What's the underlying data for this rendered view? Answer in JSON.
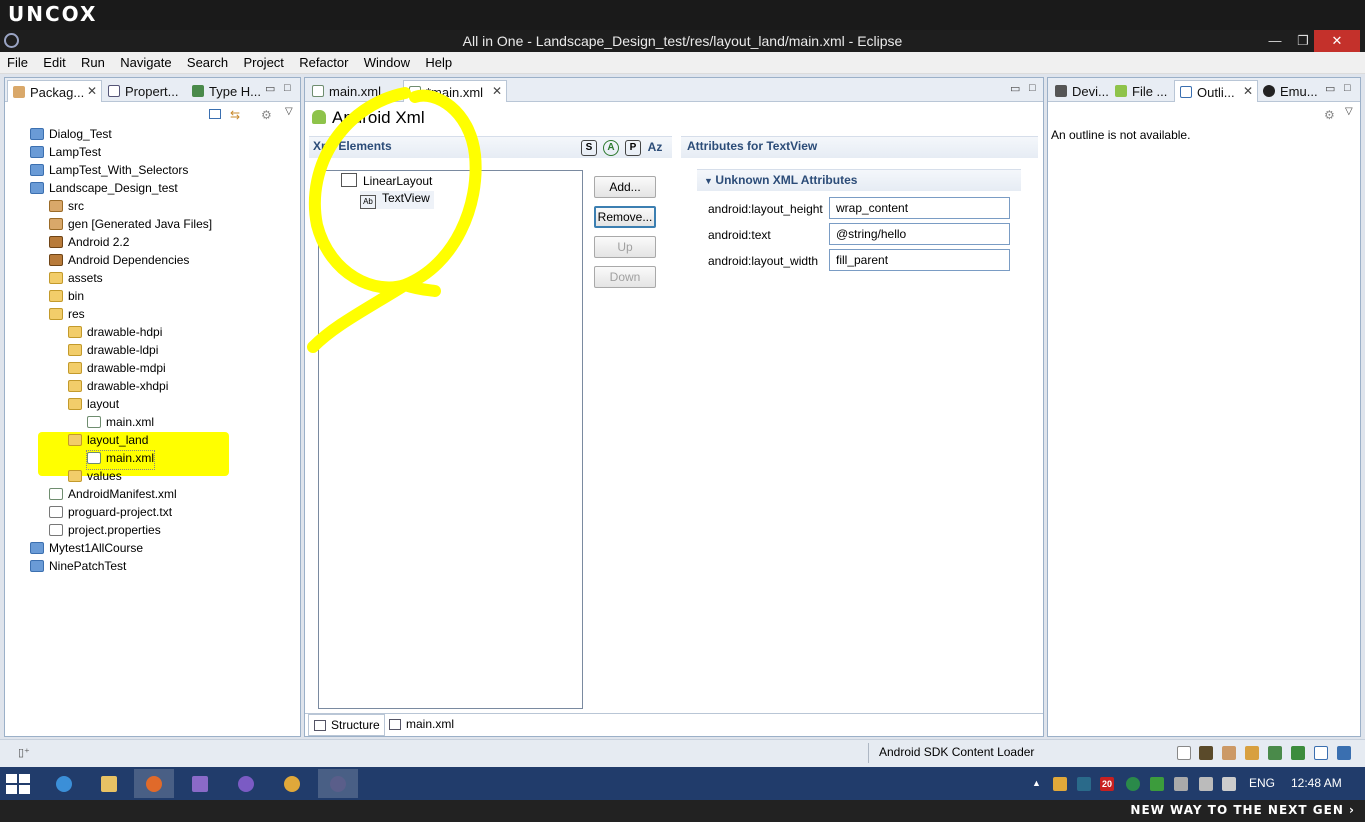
{
  "banner": {
    "logo": "UNCOX",
    "tagline": "NEW WAY TO THE NEXT GEN ›"
  },
  "window": {
    "title": "All in One - Landscape_Design_test/res/layout_land/main.xml - Eclipse",
    "minimize": "—",
    "restore": "❐",
    "close": "✕"
  },
  "menu": [
    "File",
    "Edit",
    "Run",
    "Navigate",
    "Search",
    "Project",
    "Refactor",
    "Window",
    "Help"
  ],
  "left_tabs": [
    "Packag...",
    "Propert...",
    "Type H..."
  ],
  "tree": [
    {
      "label": "Dialog_Test",
      "icon": "project"
    },
    {
      "label": "LampTest",
      "icon": "project"
    },
    {
      "label": "LampTest_With_Selectors",
      "icon": "project"
    },
    {
      "label": "Landscape_Design_test",
      "icon": "project"
    },
    {
      "label": "src",
      "icon": "package-folder"
    },
    {
      "label": "gen [Generated Java Files]",
      "icon": "package-folder"
    },
    {
      "label": "Android 2.2",
      "icon": "library"
    },
    {
      "label": "Android Dependencies",
      "icon": "library"
    },
    {
      "label": "assets",
      "icon": "folder"
    },
    {
      "label": "bin",
      "icon": "folder"
    },
    {
      "label": "res",
      "icon": "folder"
    },
    {
      "label": "drawable-hdpi",
      "icon": "folder"
    },
    {
      "label": "drawable-ldpi",
      "icon": "folder"
    },
    {
      "label": "drawable-mdpi",
      "icon": "folder"
    },
    {
      "label": "drawable-xhdpi",
      "icon": "folder"
    },
    {
      "label": "layout",
      "icon": "folder"
    },
    {
      "label": "main.xml",
      "icon": "xml-file"
    },
    {
      "label": "layout_land",
      "icon": "folder"
    },
    {
      "label": "main.xml",
      "icon": "xml-file"
    },
    {
      "label": "values",
      "icon": "folder"
    },
    {
      "label": "AndroidManifest.xml",
      "icon": "xml-file"
    },
    {
      "label": "proguard-project.txt",
      "icon": "text-file"
    },
    {
      "label": "project.properties",
      "icon": "text-file"
    },
    {
      "label": "Mytest1AllCourse",
      "icon": "project"
    },
    {
      "label": "NinePatchTest",
      "icon": "project"
    }
  ],
  "editor": {
    "tabs": [
      "main.xml",
      "*main.xml"
    ],
    "heading": "Android Xml",
    "xml_elements_title": "Xml Elements",
    "tool_buttons": [
      "S",
      "A",
      "P",
      "Az"
    ],
    "nodes": [
      "LinearLayout",
      "TextView"
    ],
    "node_icon": "Ab",
    "buttons": {
      "add": "Add...",
      "remove": "Remove...",
      "up": "Up",
      "down": "Down"
    },
    "attributes_title": "Attributes for TextView",
    "unknown_attrs_title": "Unknown XML Attributes",
    "attributes": [
      {
        "name": "android:layout_height",
        "value": "wrap_content"
      },
      {
        "name": "android:text",
        "value": "@string/hello"
      },
      {
        "name": "android:layout_width",
        "value": "fill_parent"
      }
    ],
    "bottom_tabs": [
      "Structure",
      "main.xml"
    ]
  },
  "right_tabs": [
    "Devi...",
    "File ...",
    "Outli...",
    "Emu..."
  ],
  "outline_message": "An outline is not available.",
  "status": {
    "message": "Android SDK Content Loader"
  },
  "taskbar": {
    "language": "ENG",
    "time": "12:48 AM",
    "tray_badge": "20"
  },
  "colors": {
    "highlight": "#ffff00",
    "taskbar": "#213c6b"
  }
}
